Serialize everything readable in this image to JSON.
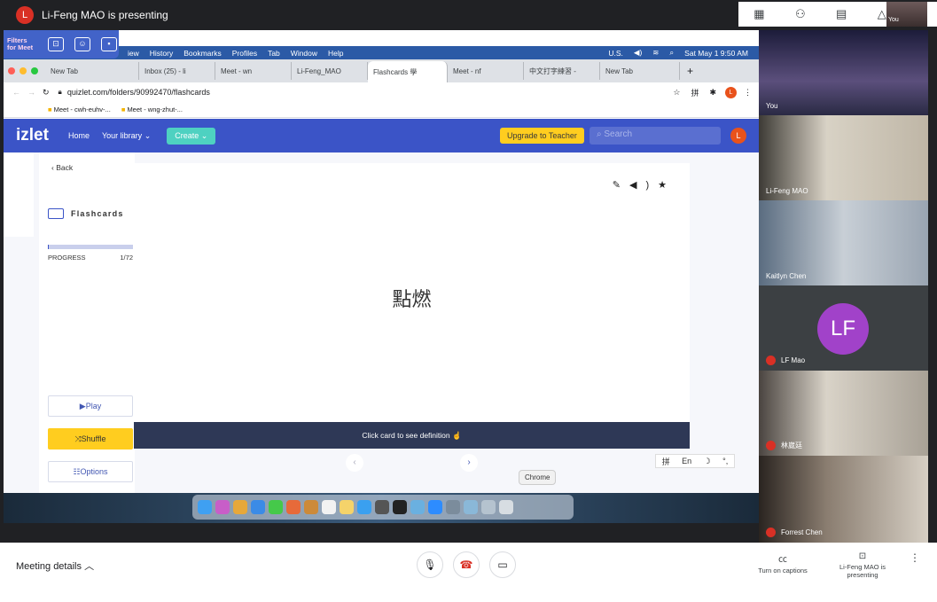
{
  "meet": {
    "presenter_banner": "Li-Feng MAO is presenting",
    "presenter_initial": "L",
    "self_label": "You"
  },
  "filters_ext": {
    "label": "Filters for Meet"
  },
  "menubar": {
    "items": [
      "iew",
      "History",
      "Bookmarks",
      "Profiles",
      "Tab",
      "Window",
      "Help"
    ],
    "right": [
      "U.S.",
      "Sat May 1  9:50 AM"
    ]
  },
  "tabs": [
    {
      "label": "New Tab",
      "active": false
    },
    {
      "label": "Inbox (25) - li",
      "active": false
    },
    {
      "label": "Meet - wn",
      "active": false
    },
    {
      "label": "Li-Feng_MAO",
      "active": false
    },
    {
      "label": "Flashcards 學",
      "active": true
    },
    {
      "label": "Meet - nf",
      "active": false
    },
    {
      "label": "中文打字練習 -",
      "active": false
    },
    {
      "label": "New Tab",
      "active": false
    }
  ],
  "address": {
    "url": "quizlet.com/folders/90992470/flashcards"
  },
  "bookmarks": [
    "Meet - cwh-euhv-...",
    "Meet - wng-zhut-..."
  ],
  "quizlet": {
    "logo": "izlet",
    "nav": [
      "Home",
      "Your library"
    ],
    "create": "Create",
    "upgrade": "Upgrade to Teacher",
    "search_placeholder": "Search",
    "avatar": "L",
    "back": "Back",
    "mode": "Flashcards",
    "progress_label": "PROGRESS",
    "progress_text": "1/72",
    "progress_fraction": 0.014,
    "play": "Play",
    "shuffle": "Shuffle",
    "options": "Options",
    "term": "點燃",
    "hint": "Click card to see definition",
    "ime": [
      "拼",
      "En"
    ]
  },
  "dock": {
    "tooltip": "Chrome"
  },
  "participants": [
    {
      "name": "You",
      "muted": false
    },
    {
      "name": "Li-Feng MAO",
      "muted": false
    },
    {
      "name": "Kaitlyn Chen",
      "muted": false
    },
    {
      "name": "LF Mao",
      "initials": "LF",
      "muted": true
    },
    {
      "name": "林崴廷",
      "muted": true
    },
    {
      "name": "Forrest Chen",
      "muted": true
    }
  ],
  "bottom": {
    "meeting_details": "Meeting details",
    "captions": "Turn on captions",
    "presenting": "Li-Feng MAO is presenting"
  }
}
